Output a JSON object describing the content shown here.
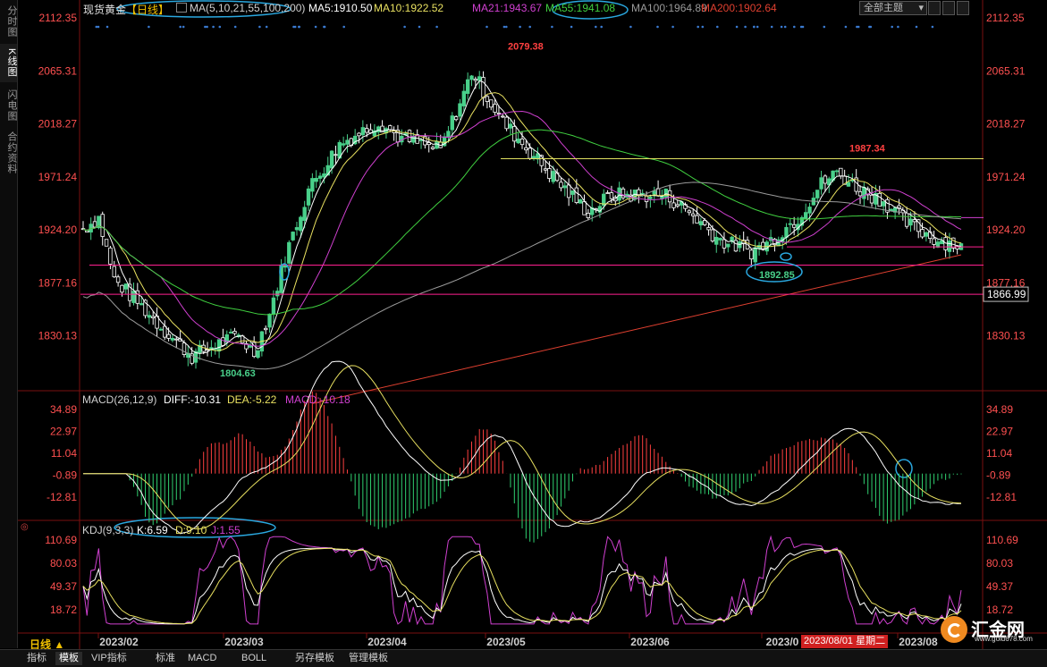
{
  "instrument": {
    "name": "现货黄金",
    "period_tag": "【日线】"
  },
  "main_indicator": {
    "label": "MA(5,10,21,55,100,200)",
    "items": [
      {
        "text": "MA5:1910.50",
        "color": "#ffffff"
      },
      {
        "text": "MA10:1922.52",
        "color": "#e8e060"
      },
      {
        "text": "MA21:1943.67",
        "color": "#d040d0"
      },
      {
        "text": "MA55:1941.08",
        "color": "#40d040"
      },
      {
        "text": "MA100:1964.89",
        "color": "#9a9a9a"
      },
      {
        "text": "MA200:1902.64",
        "color": "#e04030"
      }
    ]
  },
  "theme_select": {
    "value": "全部主题"
  },
  "side_tabs": [
    "分时图",
    "K线图",
    "闪电图",
    "合约资料"
  ],
  "price_axis": {
    "ticks": [
      "2112.35",
      "2065.31",
      "2018.27",
      "1971.24",
      "1924.20",
      "1877.16",
      "1830.13"
    ]
  },
  "price_marks": {
    "high": "2079.38",
    "low": "1804.63",
    "swing_high": "1987.34",
    "swing_low": "1892.85",
    "level_box": "1866.99"
  },
  "macd": {
    "label": "MACD(26,12,9)",
    "diff": "DIFF:-10.31",
    "dea": "DEA:-5.22",
    "macd": "MACD:-10.18",
    "ticks": [
      "34.89",
      "22.97",
      "11.04",
      "-0.89",
      "-12.81"
    ]
  },
  "kdj": {
    "label": "KDJ(9,3,3)",
    "k": "K:6.59",
    "d": "D:9.10",
    "j": "J:1.55",
    "ticks": [
      "110.69",
      "80.03",
      "49.37",
      "18.72"
    ]
  },
  "time_axis": {
    "labels": [
      "2023/02",
      "2023/03",
      "2023/04",
      "2023/05",
      "2023/06",
      "2023/0",
      "2023/08"
    ],
    "cursor_label": "2023/08/01 星期二"
  },
  "period_button": "日线 ▲",
  "bottom_tabs": [
    "指标",
    "模板",
    "VIP指标",
    "标准",
    "MACD",
    "BOLL",
    "另存模板",
    "管理模板"
  ],
  "bottom_tab_active": "模板",
  "logo": {
    "text": "汇金网",
    "url": "www.gold678.com"
  },
  "colors": {
    "up": "#49d08a",
    "down": "#f05050",
    "ma5": "#ffffff",
    "ma10": "#e8e060",
    "ma21": "#d040d0",
    "ma55": "#40d040",
    "ma100": "#9a9a9a",
    "ma200": "#e04030",
    "axis_text": "#ff5050",
    "annot": "#2aa8e0"
  }
}
